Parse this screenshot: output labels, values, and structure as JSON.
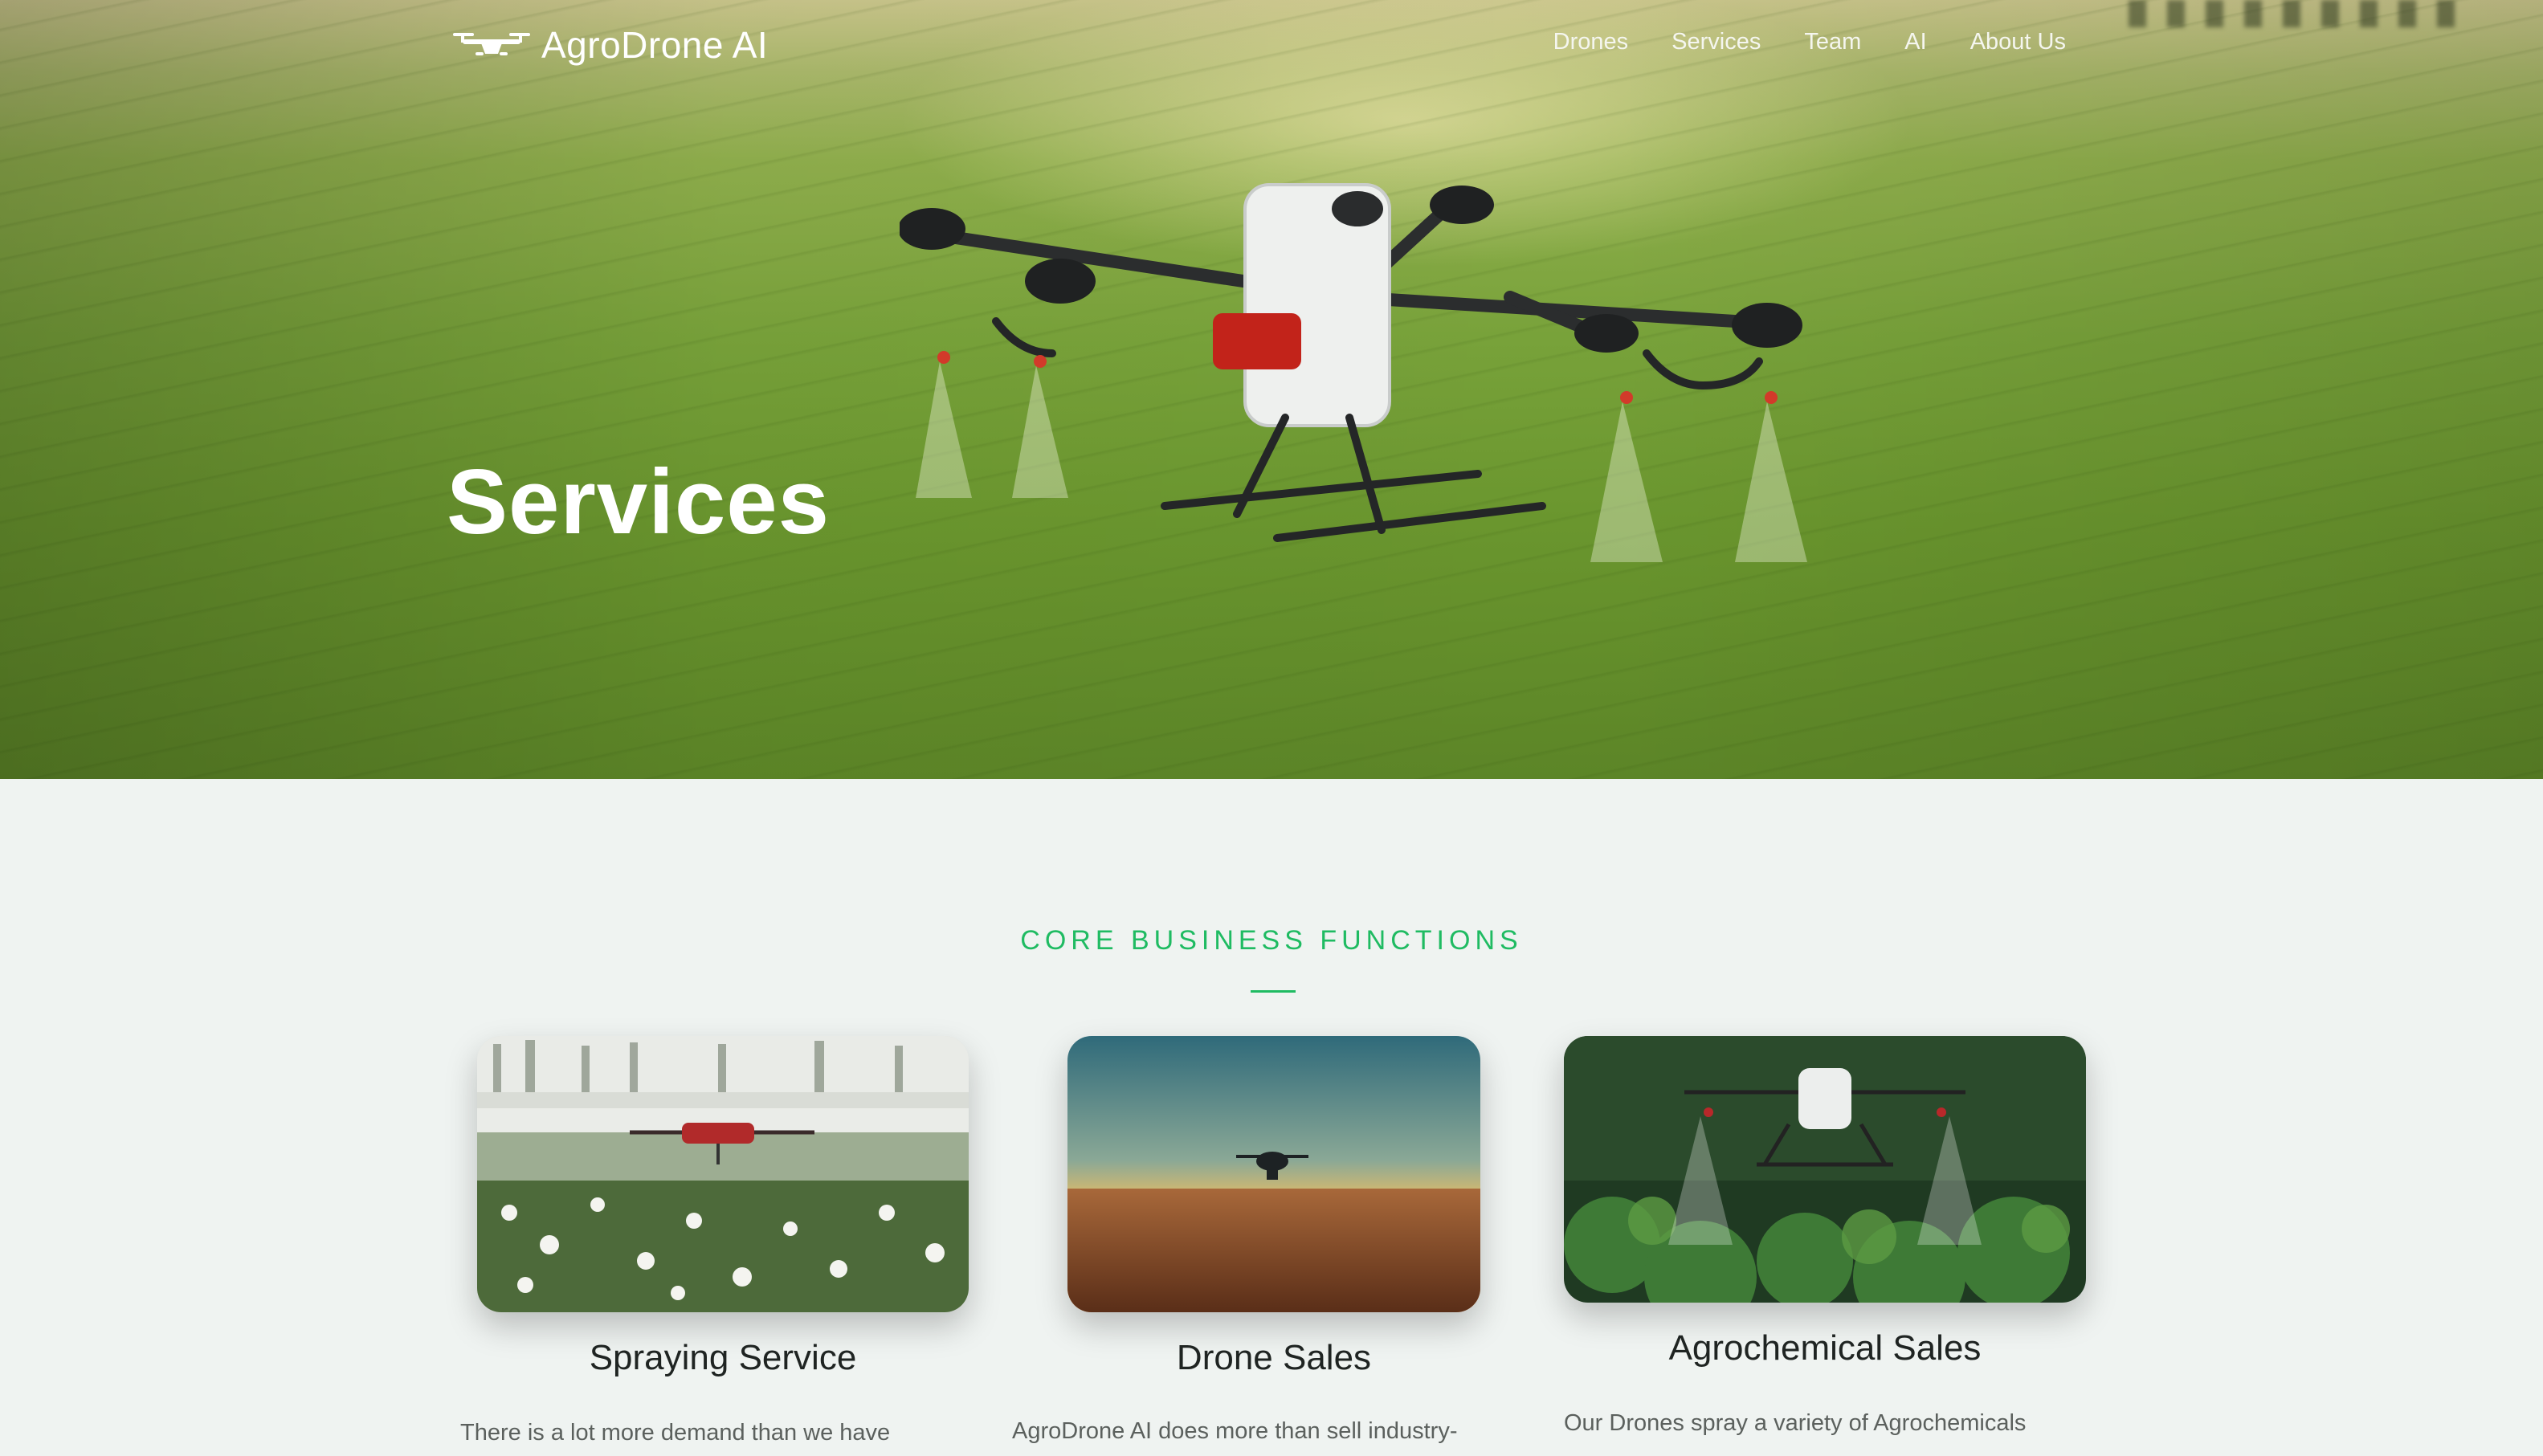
{
  "brand": {
    "name": "AgroDrone AI"
  },
  "nav": {
    "items": [
      {
        "label": "Drones"
      },
      {
        "label": "Services"
      },
      {
        "label": "Team"
      },
      {
        "label": "AI"
      },
      {
        "label": "About Us"
      }
    ]
  },
  "hero": {
    "title": "Services"
  },
  "section": {
    "label": "CORE BUSINESS FUNCTIONS"
  },
  "cards": [
    {
      "title": "Spraying Service",
      "text": "There is a lot more demand than we have",
      "image": "drone spraying over cotton field"
    },
    {
      "title": "Drone Sales",
      "text": "AgroDrone AI does more than sell industry-",
      "image": "drone flying over wheat field at sunset"
    },
    {
      "title": "Agrochemical Sales",
      "text": "Our Drones spray a variety of Agrochemicals",
      "image": "spray drone over green crops"
    }
  ],
  "colors": {
    "accent": "#1fbb62",
    "background": "#eff3f1",
    "title_text": "#1f2422",
    "body_text": "#5b605d"
  }
}
